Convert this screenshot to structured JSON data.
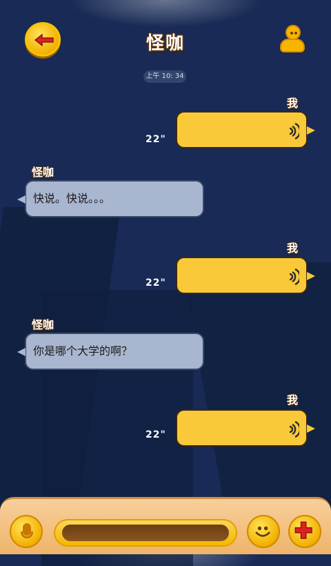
{
  "header": {
    "title": "怪咖"
  },
  "chat": {
    "timestamp": "上午 10: 34",
    "messages": [
      {
        "sender": "我",
        "type": "voice",
        "duration": "22\""
      },
      {
        "sender": "怪咖",
        "type": "text",
        "text": "快说。快说。。。"
      },
      {
        "sender": "我",
        "type": "voice",
        "duration": "22\""
      },
      {
        "sender": "怪咖",
        "type": "text",
        "text": "你是哪个大学的啊？"
      },
      {
        "sender": "我",
        "type": "voice",
        "duration": "22\""
      }
    ]
  },
  "input": {
    "placeholder": ""
  },
  "icons": {
    "back": "back-arrow-icon",
    "profile": "user-profile-icon",
    "voice": "voice-wave-icon",
    "mic": "microphone-icon",
    "emoji": "smiley-icon",
    "more": "plus-icon"
  },
  "colors": {
    "background": "#182a55",
    "accent": "#f9c93a",
    "incoming_bubble": "#a9b6d0",
    "bottom_bar": "#f2c27f"
  }
}
